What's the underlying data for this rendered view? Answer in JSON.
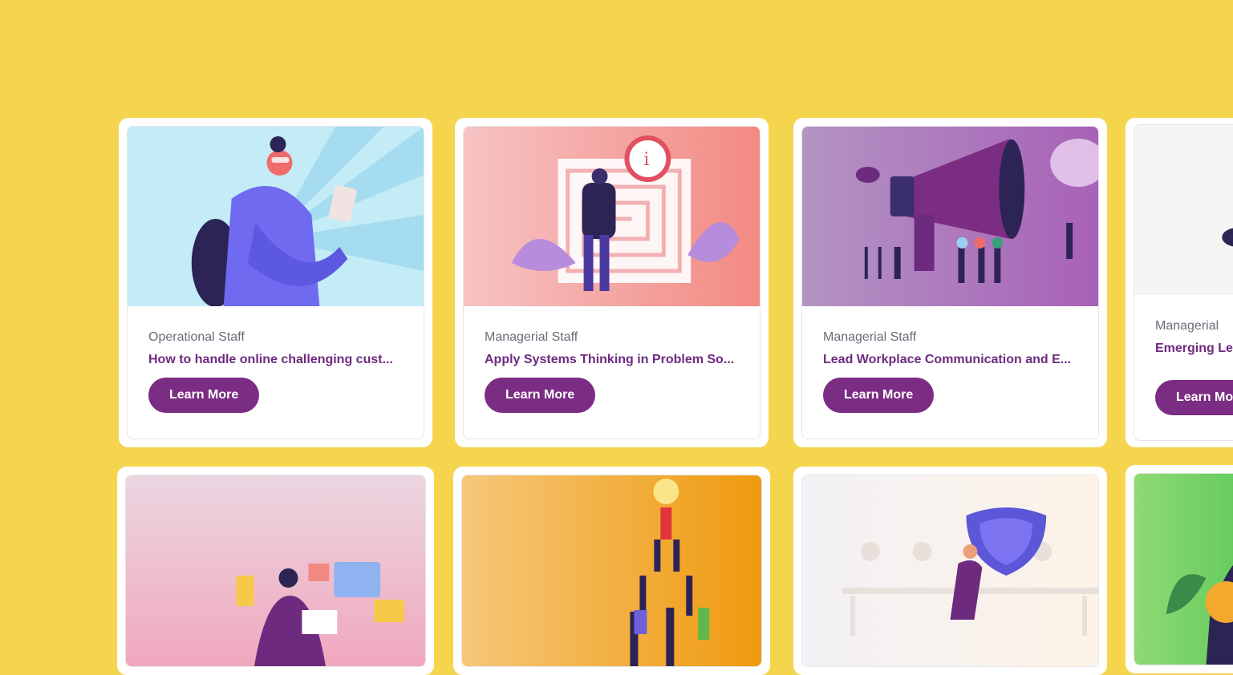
{
  "courses_row1": [
    {
      "category": "Operational Staff",
      "title": "How to handle online challenging cust...",
      "button": "Learn More"
    },
    {
      "category": "Managerial Staff",
      "title": "Apply Systems Thinking in Problem So...",
      "button": "Learn More"
    },
    {
      "category": "Managerial Staff",
      "title": "Lead Workplace Communication and E...",
      "button": "Learn More"
    },
    {
      "category": "Managerial",
      "title": "Emerging Le",
      "button": "Learn Mo"
    }
  ],
  "colors": {
    "background": "#f5d54e",
    "button": "#7b2d83",
    "title": "#6d2a7f",
    "category": "#6b6b7a"
  }
}
